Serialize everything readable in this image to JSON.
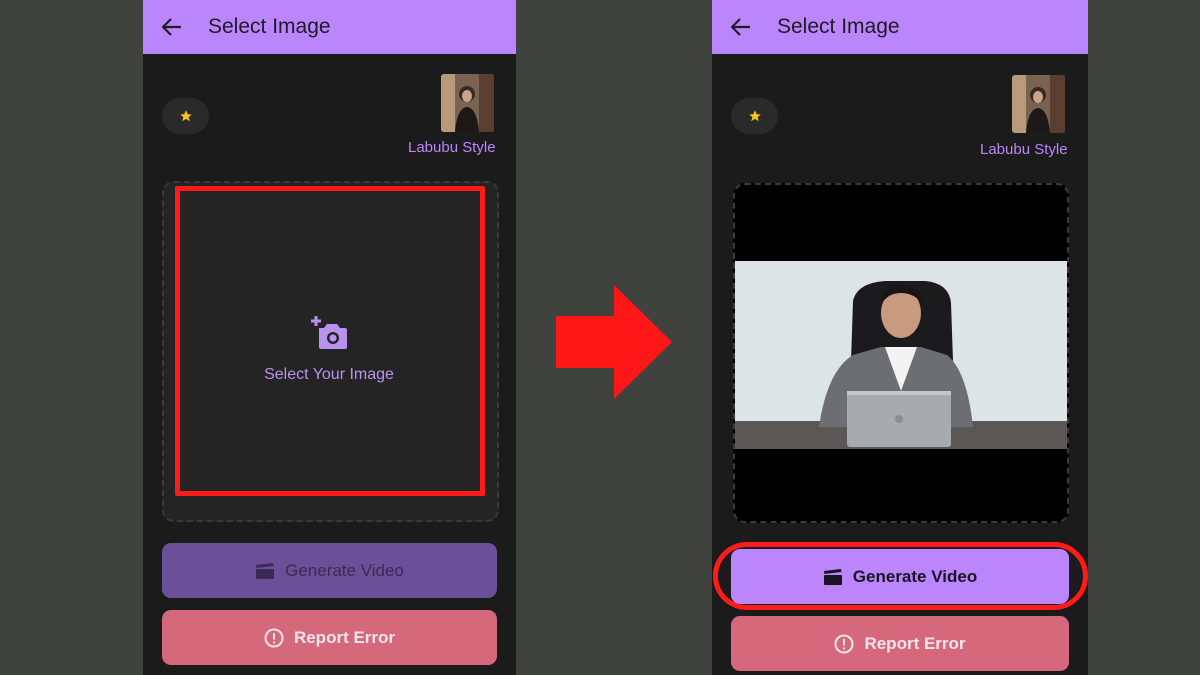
{
  "left_screen": {
    "title": "Select Image",
    "style_label": "Labubu Style",
    "select_label": "Select Your Image",
    "generate_label": "Generate Video",
    "report_label": "Report Error"
  },
  "right_screen": {
    "title": "Select Image",
    "style_label": "Labubu Style",
    "generate_label": "Generate Video",
    "report_label": "Report Error"
  },
  "colors": {
    "background": "#3f423d",
    "app_surface": "#1b1b1b",
    "accent": "#bb86fc",
    "accent_disabled": "#6c4f99",
    "danger_button": "#d6687c",
    "highlight": "#ff1b1b",
    "star": "#f5c518"
  },
  "icons": [
    "back-arrow-icon",
    "star-icon",
    "add-photo-icon",
    "clapperboard-icon",
    "alert-circle-icon",
    "right-arrow-icon"
  ]
}
